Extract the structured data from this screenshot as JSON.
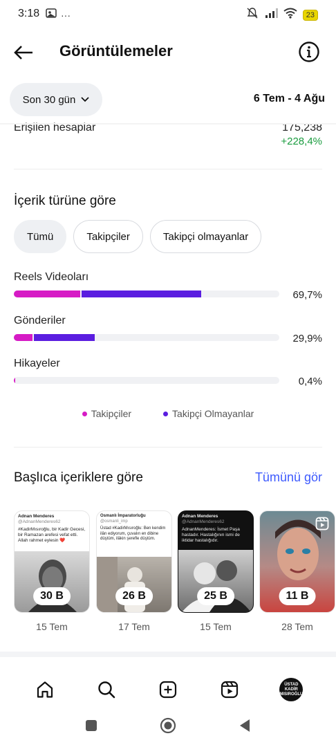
{
  "status_bar": {
    "time": "3:18",
    "more": "···",
    "battery": "23"
  },
  "header": {
    "title": "Görüntülemeler"
  },
  "date_filter": {
    "range_label": "Son 30 gün",
    "date_range": "6 Tem - 4 Ağu"
  },
  "reach": {
    "label": "Erişilen hesaplar",
    "value": "175,238",
    "change": "+228,4%"
  },
  "content_type": {
    "title": "İçerik türüne göre",
    "chips": [
      {
        "label": "Tümü",
        "active": true
      },
      {
        "label": "Takipçiler",
        "active": false
      },
      {
        "label": "Takipçi olmayanlar",
        "active": false
      }
    ],
    "bars": [
      {
        "label": "Reels Videoları",
        "percent_label": "69,7%",
        "followers": 0.25,
        "non_followers": 0.45
      },
      {
        "label": "Gönderiler",
        "percent_label": "29,9%",
        "followers": 0.07,
        "non_followers": 0.23
      },
      {
        "label": "Hikayeler",
        "percent_label": "0,4%",
        "followers": 0.004,
        "non_followers": 0.0
      }
    ],
    "legend": [
      {
        "label": "Takipçiler",
        "color": "#d61bc5"
      },
      {
        "label": "Takipçi Olmayanlar",
        "color": "#5a1de0"
      }
    ]
  },
  "top_content": {
    "title": "Başlıca içeriklere göre",
    "see_all": "Tümünü gör",
    "items": [
      {
        "views": "30 B",
        "date": "15 Tem",
        "thumb_title": "Adnan Menderes",
        "thumb_handle": "@AdnanMenderes62",
        "thumb_text": "#KadirMısıroğlu, bir Kadir Gecesi, bir Ramazan arefesi vefat etti. Allah rahmet eylesin ❤️",
        "type": "post"
      },
      {
        "views": "26 B",
        "date": "17 Tem",
        "thumb_title": "Osmanlı İmparatorluğu",
        "thumb_handle": "@osmanli_imp",
        "thumb_text": "Üstad #KadirMısıroğlu: Ben kendim ilân ediyorum, çuvalın en dibine düştüm, ilâkin şerefle düştüm.",
        "type": "post"
      },
      {
        "views": "25 B",
        "date": "15 Tem",
        "thumb_title": "Adnan Menderes",
        "thumb_handle": "@AdnanMenderes62",
        "thumb_text": "AdnanMenderes: İsmet Paşa hastadır. Hastalığının ismi de iktidar hastalığıdır.",
        "type": "post"
      },
      {
        "views": "11 B",
        "date": "28 Tem",
        "type": "reel"
      }
    ]
  },
  "bottom_nav": {
    "avatar_text": "ÜSTAD KADİR MISIROĞLU"
  }
}
